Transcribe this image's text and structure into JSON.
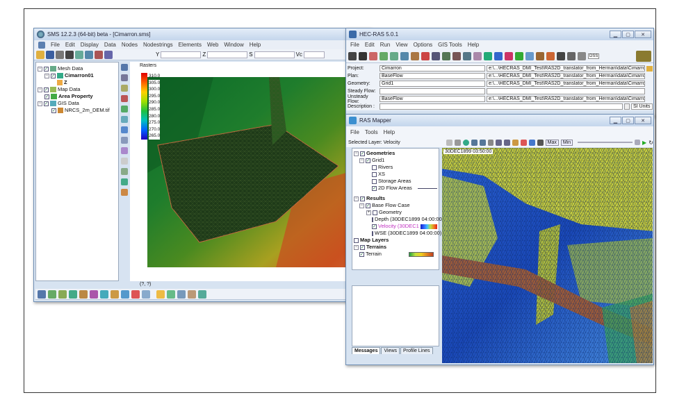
{
  "sms": {
    "title": "SMS 12.2.3 (64-bit) beta - [Cimarron.sms]",
    "menu": [
      "File",
      "Edit",
      "Display",
      "Data",
      "Nodes",
      "Nodestrings",
      "Elements",
      "Web",
      "Window",
      "Help"
    ],
    "coord_labels": [
      "Y",
      "Z",
      "S",
      "Vc"
    ],
    "tree": {
      "mesh_data": "Mesh Data",
      "mesh_name": "Cimarron01",
      "z": "Z",
      "map_data": "Map Data",
      "area_property": "Area Property",
      "gis_data": "GIS Data",
      "dem": "NRCS_2m_DEM.tif"
    },
    "rasters_label": "Rasters",
    "legend_values": [
      "310.0",
      "305.0",
      "300.0",
      "295.0",
      "290.0",
      "285.0",
      "280.0",
      "275.0",
      "270.0",
      "265.0"
    ],
    "status": "(?, ?)"
  },
  "hecras": {
    "title": "HEC-RAS 5.0.1",
    "menu": [
      "File",
      "Edit",
      "Run",
      "View",
      "Options",
      "GIS Tools",
      "Help"
    ],
    "dss_label": "DSS",
    "rows": [
      {
        "label": "Project:",
        "name": "Cimarron",
        "path": "e:\\...\\HECRAS_DMI_Test\\RAS2D_translator_from_Herman\\data\\Cimarron.prj"
      },
      {
        "label": "Plan:",
        "name": "BaseFlow",
        "path": "e:\\...\\HECRAS_DMI_Test\\RAS2D_translator_from_Herman\\data\\Cimarron.p01"
      },
      {
        "label": "Geometry:",
        "name": "Grid1",
        "path": "e:\\...\\HECRAS_DMI_Test\\RAS2D_translator_from_Herman\\data\\Cimarron.g01"
      },
      {
        "label": "Steady Flow:",
        "name": "",
        "path": ""
      },
      {
        "label": "Unsteady Flow:",
        "name": "BaseFlow",
        "path": "e:\\...\\HECRAS_DMI_Test\\RAS2D_translator_from_Herman\\data\\Cimarron.u01"
      },
      {
        "label": "Description :",
        "name": "",
        "path": ""
      }
    ],
    "units": "SI Units"
  },
  "rasmapper": {
    "title": "RAS Mapper",
    "menu": [
      "File",
      "Tools",
      "Help"
    ],
    "selected_layer": "Selected Layer: Velocity",
    "max_label": "Max",
    "min_label": "Min",
    "timestamp": "30DEC1899 03:50:00",
    "tree": {
      "geometries": "Geometries",
      "grid1": "Grid1",
      "rivers": "Rivers",
      "xs": "XS",
      "storage": "Storage Areas",
      "flow2d": "2D Flow Areas",
      "results": "Results",
      "base_flow": "Base Flow Case",
      "geometry": "Geometry",
      "depth": "Depth (30DEC1899 04:00:00)",
      "velocity": "Velocity (30DEC1",
      "wse": "WSE (30DEC1899 04:00:00)",
      "map_layers": "Map Layers",
      "terrains": "Terrains",
      "terrain": "Terrain"
    },
    "tabs": [
      "Messages",
      "Views",
      "Profile Lines"
    ]
  }
}
